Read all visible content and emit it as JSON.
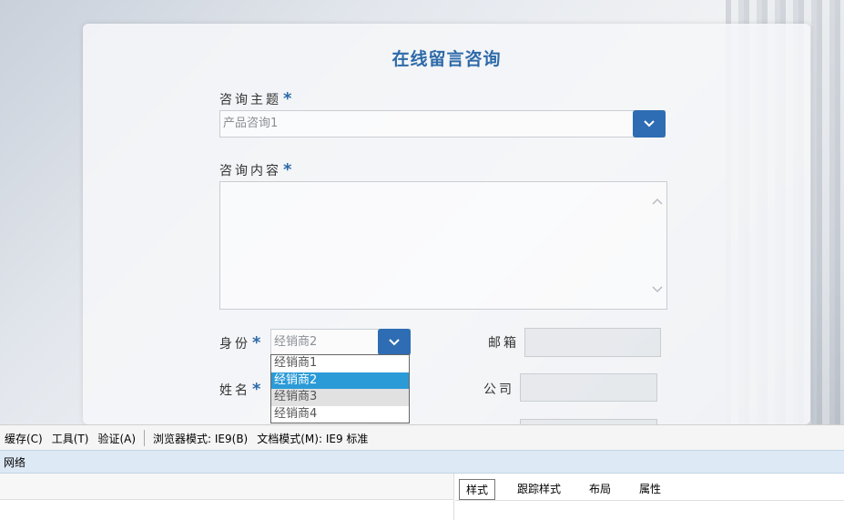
{
  "form": {
    "title": "在线留言咨询",
    "topic_label": "咨询主题",
    "topic_value": "产品咨询1",
    "content_label": "咨询内容",
    "identity_label": "身份",
    "identity_value": "经销商2",
    "identity_options": [
      "经销商1",
      "经销商2",
      "经销商3",
      "经销商4"
    ],
    "name_label": "姓名",
    "email_label": "邮箱",
    "company_label": "公司",
    "required_mark": "*"
  },
  "devtools": {
    "menu": [
      "缓存(C)",
      "工具(T)",
      "验证(A)",
      "浏览器模式: IE9(B)",
      "文档模式(M): IE9 标准"
    ],
    "network_label": "网络",
    "tabs": [
      "样式",
      "跟踪样式",
      "布局",
      "属性"
    ]
  },
  "colors": {
    "accent": "#2e6db3",
    "selected": "#2b9bd8"
  }
}
